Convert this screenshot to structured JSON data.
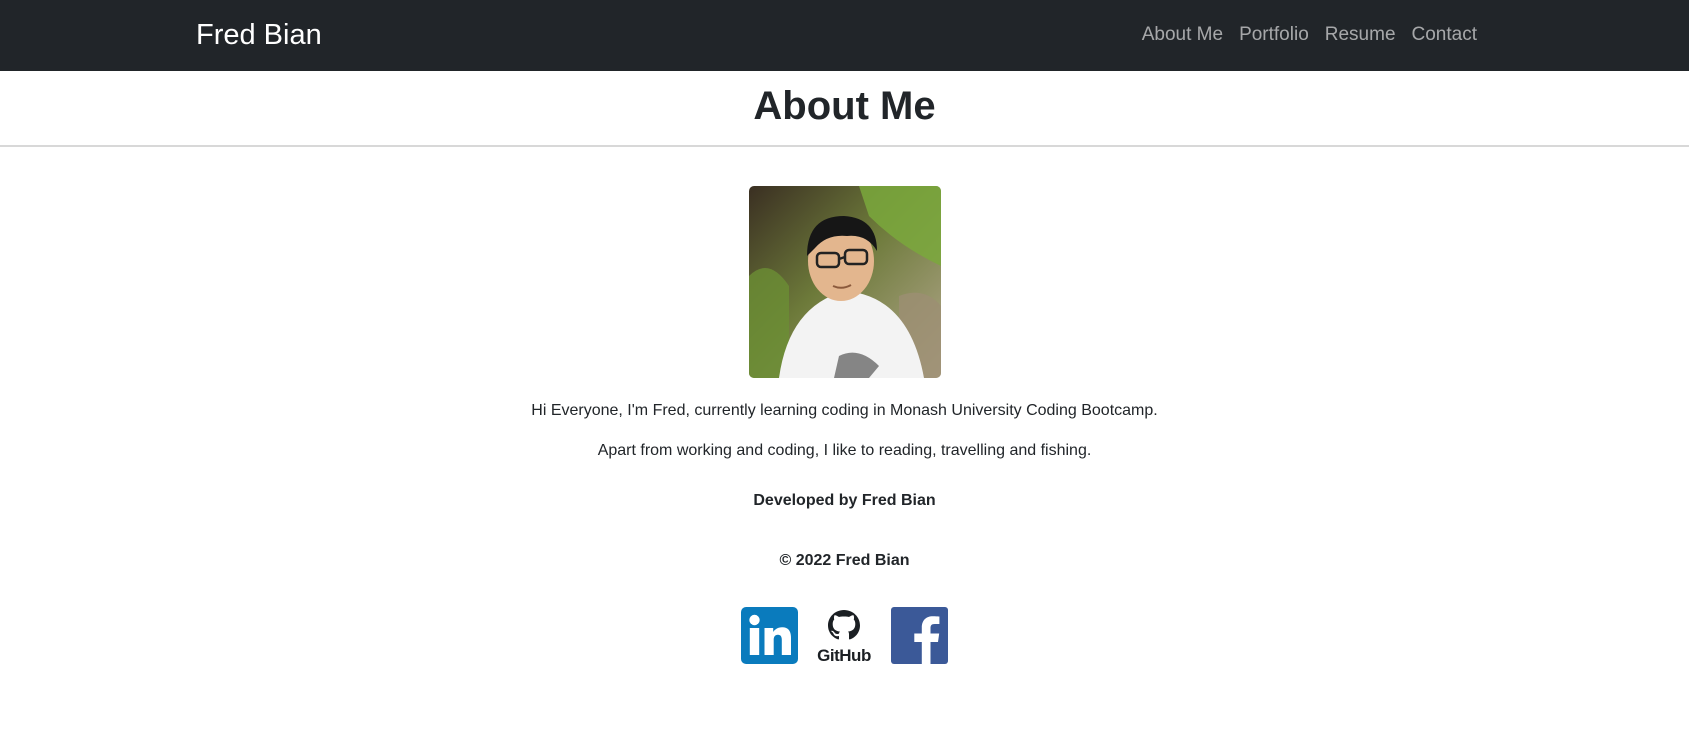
{
  "navbar": {
    "brand": "Fred Bian",
    "links": [
      {
        "label": "About Me"
      },
      {
        "label": "Portfolio"
      },
      {
        "label": "Resume"
      },
      {
        "label": "Contact"
      }
    ]
  },
  "header": {
    "title": "About Me"
  },
  "main": {
    "bio": [
      "Hi Everyone, I'm Fred, currently learning coding in Monash University Coding Bootcamp.",
      "Apart from working and coding, I like to reading, travelling and fishing."
    ]
  },
  "footer": {
    "developed_by": "Developed by Fred Bian",
    "copyright": "© 2022 Fred Bian",
    "social": [
      {
        "icon": "linkedin-icon",
        "label": "in"
      },
      {
        "icon": "github-icon",
        "label": "GitHub"
      },
      {
        "icon": "facebook-icon",
        "label": "f"
      }
    ]
  },
  "colors": {
    "navbar_bg": "#212529",
    "linkedin": "#0A7BBD",
    "facebook": "#3B5998"
  }
}
